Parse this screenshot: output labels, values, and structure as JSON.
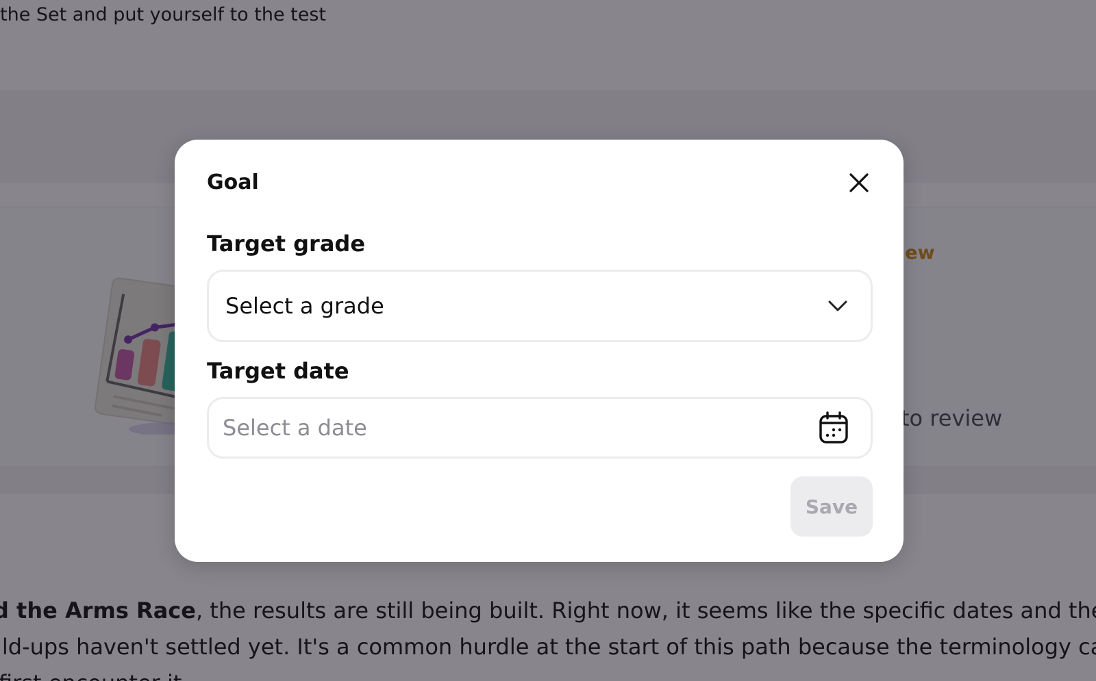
{
  "background": {
    "top_text": "the Set and put yourself to the test",
    "review_link": "iew",
    "review_text": "to review",
    "paragraph": {
      "line1_bold": "d the Arms Race",
      "line1_rest": ", the results are still being built. Right now, it seems like the specific dates and the tec",
      "line2": "ild-ups haven't settled yet. It's a common hurdle at the start of this path because the terminology car",
      "line3": "first encounter it"
    }
  },
  "modal": {
    "title": "Goal",
    "close_icon": "close-icon",
    "target_grade": {
      "label": "Target grade",
      "value": "Select a grade",
      "icon": "chevron-down-icon"
    },
    "target_date": {
      "label": "Target date",
      "placeholder": "Select a date",
      "icon": "calendar-icon"
    },
    "save_label": "Save"
  },
  "colors": {
    "overlay": "#120e1a",
    "accent_link": "#c98a1d",
    "save_disabled_bg": "#ececef",
    "save_disabled_text": "#a9a9b0"
  }
}
